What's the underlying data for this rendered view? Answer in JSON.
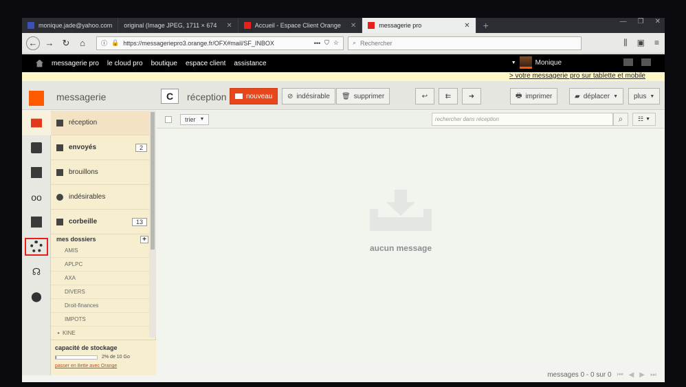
{
  "browser": {
    "tabs": [
      {
        "label": "monique.jade@yahoo.com",
        "active": false,
        "favicon_color": "#3b4fb8"
      },
      {
        "label": "original (Image JPEG, 1711 × 674",
        "active": false,
        "favicon_color": "#2b2d33"
      },
      {
        "label": "Accueil - Espace Client Orange",
        "active": false,
        "favicon_color": "#e8201b"
      },
      {
        "label": "messagerie pro",
        "active": true,
        "favicon_color": "#e8201b"
      }
    ],
    "url": "https://messageriepro3.orange.fr/OFX#mail/SF_INBOX",
    "search_placeholder": "Rechercher"
  },
  "portal": {
    "links": [
      "messagerie pro",
      "le cloud pro",
      "boutique",
      "espace client",
      "assistance"
    ],
    "user_name": "Monique",
    "promo": "> votre messagerie pro sur tablette et mobile"
  },
  "header": {
    "app_title": "messagerie",
    "refresh": "C",
    "folder_title": "réception",
    "new_label": "nouveau",
    "spam_label": "indésirable",
    "delete_label": "supprimer",
    "print_label": "imprimer",
    "move_label": "déplacer",
    "more_label": "plus"
  },
  "folders": {
    "main": [
      {
        "label": "réception",
        "count": "",
        "bold": false,
        "active": true
      },
      {
        "label": "envoyés",
        "count": "2",
        "bold": true,
        "active": false
      },
      {
        "label": "brouillons",
        "count": "",
        "bold": false,
        "active": false
      },
      {
        "label": "indésirables",
        "count": "",
        "bold": false,
        "active": false
      },
      {
        "label": "corbeille",
        "count": "13",
        "bold": true,
        "active": false
      }
    ],
    "my_folders_title": "mes dossiers",
    "add": "+",
    "subfolders": [
      "AMIS",
      "APLPC",
      "AXA",
      "DIVERS",
      "Droit-finances",
      "IMPOTS",
      "KINE"
    ],
    "storage_title": "capacité de stockage",
    "storage_text": "2% de 10 Go",
    "storage_fraction": 0.02,
    "storage_link": "passer en 8ette avec Orange"
  },
  "messages": {
    "sort_label": "trier",
    "search_placeholder": "rechercher dans réception",
    "empty_text": "aucun message",
    "footer_text": "messages 0 - 0 sur 0"
  },
  "colors": {
    "brand": "#ff5a00",
    "new_button": "#e8461b",
    "accent_red": "#e8201b"
  }
}
